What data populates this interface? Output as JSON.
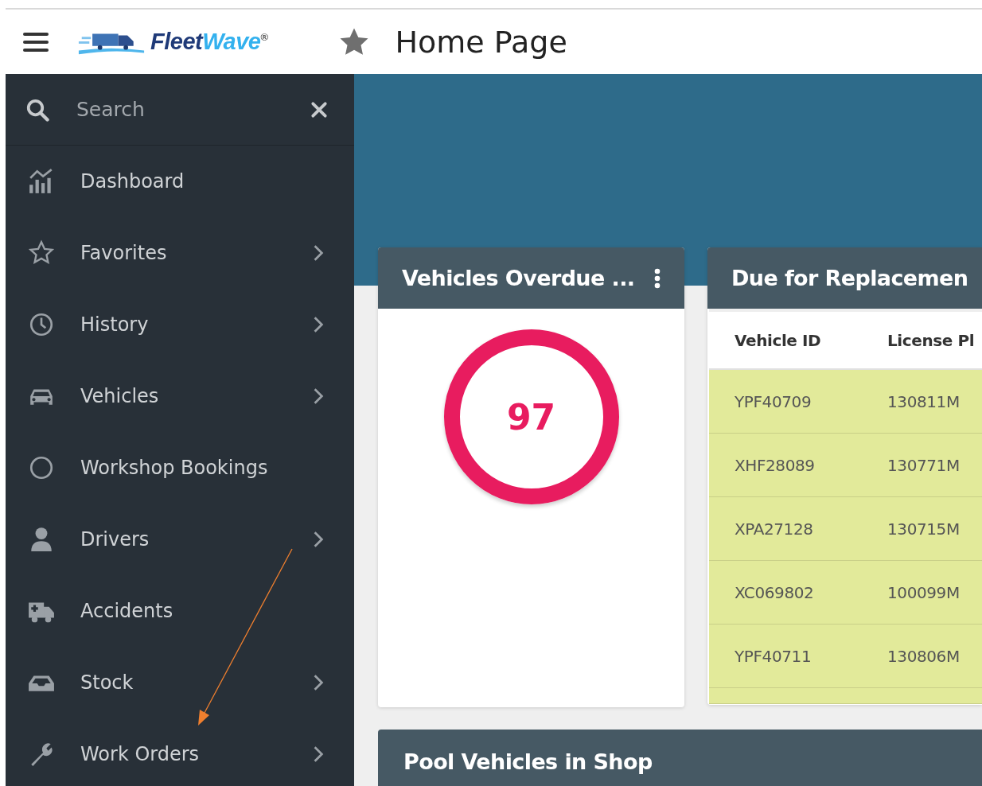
{
  "header": {
    "logo": {
      "dark": "Fleet",
      "light": "Wave",
      "mark": "®"
    },
    "favorite": true,
    "title": "Home Page"
  },
  "sidebar": {
    "search": {
      "placeholder": "Search"
    },
    "items": [
      {
        "label": "Dashboard",
        "has_submenu": false
      },
      {
        "label": "Favorites",
        "has_submenu": true
      },
      {
        "label": "History",
        "has_submenu": true
      },
      {
        "label": "Vehicles",
        "has_submenu": true
      },
      {
        "label": "Workshop Bookings",
        "has_submenu": false
      },
      {
        "label": "Drivers",
        "has_submenu": true
      },
      {
        "label": "Accidents",
        "has_submenu": false
      },
      {
        "label": "Stock",
        "has_submenu": true
      },
      {
        "label": "Work Orders",
        "has_submenu": true
      }
    ]
  },
  "overdue_card": {
    "title": "Vehicles Overdue ...",
    "value": "97"
  },
  "replacement_card": {
    "title": "Due for Replacemen",
    "columns": [
      "Vehicle ID",
      "License Pl"
    ],
    "rows": [
      [
        "YPF40709",
        "130811M"
      ],
      [
        "XHF28089",
        "130771M"
      ],
      [
        "XPA27128",
        "130715M"
      ],
      [
        "XC069802",
        "100099M"
      ],
      [
        "YPF40711",
        "130806M"
      ]
    ]
  },
  "pool_card": {
    "title": "Pool Vehicles in Shop"
  }
}
